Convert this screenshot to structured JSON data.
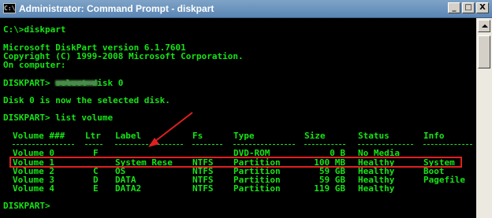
{
  "window": {
    "title": "Administrator: Command Prompt - diskpart",
    "icon_text": "C:\\",
    "minimize_label": "_",
    "maximize_label": "□",
    "close_label": "X"
  },
  "console": {
    "lines": {
      "l0": "C:\\>diskpart",
      "l1": "Microsoft DiskPart version 6.1.7601",
      "l2": "Copyright (C) 1999-2008 Microsoft Corporation.",
      "l3": "On computer:",
      "l4": "DISKPART> select disk 0",
      "l5": "Disk 0 is now the selected disk.",
      "l6": "DISKPART> list volume",
      "l7": "DISKPART>"
    },
    "headers": {
      "volume": "Volume ###",
      "ltr": "Ltr",
      "label": "Label",
      "fs": "Fs",
      "type": "Type",
      "size": "Size",
      "status": "Status",
      "info": "Info"
    },
    "volumes": [
      {
        "volume": "Volume 0",
        "ltr": "F",
        "label": "",
        "fs": "",
        "type": "DVD-ROM",
        "size": "0 B",
        "status": "No Media",
        "info": ""
      },
      {
        "volume": "Volume 1",
        "ltr": "",
        "label": "System Rese",
        "fs": "NTFS",
        "type": "Partition",
        "size": "100 MB",
        "status": "Healthy",
        "info": "System"
      },
      {
        "volume": "Volume 2",
        "ltr": "C",
        "label": "OS",
        "fs": "NTFS",
        "type": "Partition",
        "size": "59 GB",
        "status": "Healthy",
        "info": "Boot"
      },
      {
        "volume": "Volume 3",
        "ltr": "D",
        "label": "DATA",
        "fs": "NTFS",
        "type": "Partition",
        "size": "59 GB",
        "status": "Healthy",
        "info": "Pagefile"
      },
      {
        "volume": "Volume 4",
        "ltr": "E",
        "label": "DATA2",
        "fs": "NTFS",
        "type": "Partition",
        "size": "119 GB",
        "status": "Healthy",
        "info": ""
      }
    ]
  },
  "colors": {
    "console_text": "#16e416",
    "console_bg": "#000000",
    "annotation": "#e02020"
  },
  "icons": [
    "console-app-icon",
    "minimize-icon",
    "maximize-icon",
    "close-icon",
    "scroll-up-arrow-icon",
    "annotation-arrow"
  ]
}
